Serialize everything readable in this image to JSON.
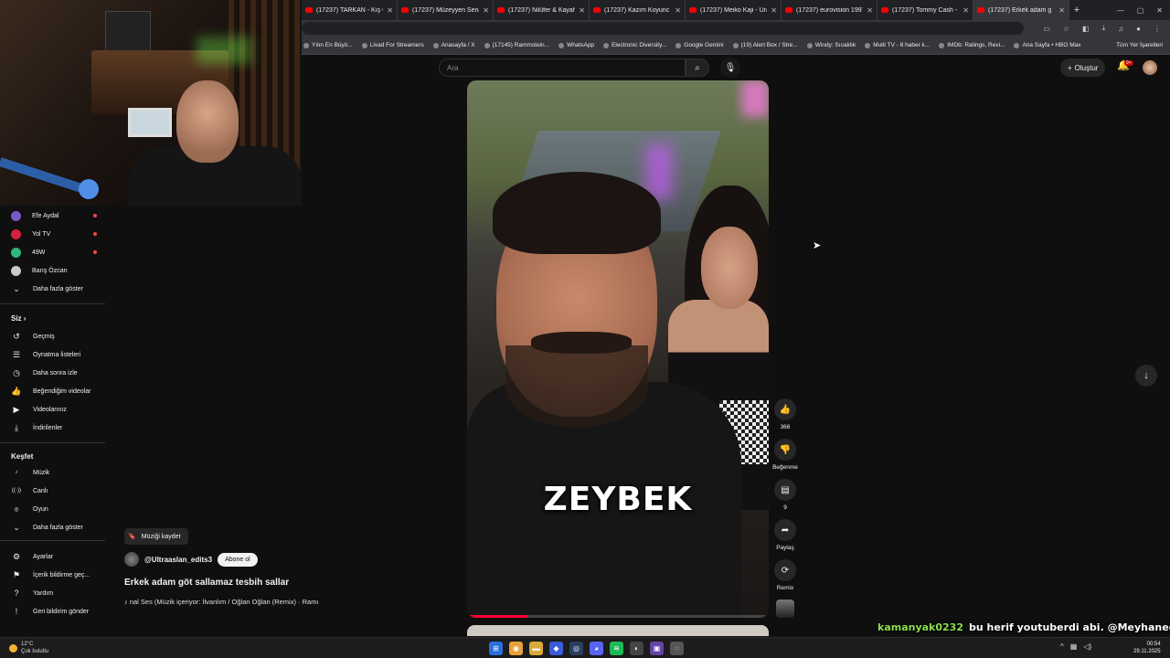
{
  "tabs": [
    {
      "label": "(17237) TARKAN - Kış Gü",
      "active": false
    },
    {
      "label": "(17237) Müzeyyen Senar",
      "active": false
    },
    {
      "label": "(17237) Nilüfer & Kayahan",
      "active": false
    },
    {
      "label": "(17237) Kazım Koyunc",
      "active": false
    },
    {
      "label": "(17237) Meiko Kaji - Ura",
      "active": false
    },
    {
      "label": "(17237) eurovision 1997",
      "active": false
    },
    {
      "label": "(17237) Tommy Cash - Es",
      "active": false
    },
    {
      "label": "(17237) Erkek adam g",
      "active": true
    }
  ],
  "bookmarks": [
    "Yılın En Büyü...",
    "Livad For Streamers",
    "Anasayfa / X",
    "(17145) Rammstein...",
    "WhatsApp",
    "Electronic Diversity...",
    "Google Gemini",
    "(19) Alert Box / Stre...",
    "Windy: Sıcaklık",
    "Multi TV - 6 haber k...",
    "IMDb: Ratings, Revi...",
    "Ana Sayfa • HBO Max"
  ],
  "bookmarks_all": "Tüm Yer İşaretleri",
  "search": {
    "placeholder": "Ara"
  },
  "header": {
    "create_label": "Oluştur",
    "notification_count": "9+"
  },
  "sidebar": {
    "subscriptions": [
      {
        "label": "Efe Aydal",
        "color": "#7a5ac8",
        "live": true
      },
      {
        "label": "Yol TV",
        "color": "#d4213d",
        "live": true
      },
      {
        "label": "49W",
        "color": "#2fb47e",
        "live": true
      },
      {
        "label": "Barış Özcan",
        "color": "#c9c9c9",
        "live": false
      }
    ],
    "show_more_subs": "Daha fazla göster",
    "you_heading": "Siz",
    "you_items": [
      {
        "label": "Geçmiş",
        "icon": "history-icon"
      },
      {
        "label": "Oynatma listeleri",
        "icon": "playlist-icon"
      },
      {
        "label": "Daha sonra izle",
        "icon": "clock-icon"
      },
      {
        "label": "Beğendiğim videolar",
        "icon": "like-icon"
      },
      {
        "label": "Videolarınız",
        "icon": "video-icon"
      },
      {
        "label": "İndirilenler",
        "icon": "download-icon"
      }
    ],
    "explore_heading": "Keşfet",
    "explore_items": [
      {
        "label": "Müzik",
        "icon": "music-icon"
      },
      {
        "label": "Canlı",
        "icon": "live-icon"
      },
      {
        "label": "Oyun",
        "icon": "gaming-icon"
      }
    ],
    "show_more_explore": "Daha fazla göster",
    "footer_items": [
      {
        "label": "Ayarlar",
        "icon": "gear-icon"
      },
      {
        "label": "İçerik bildirme geç...",
        "icon": "flag-icon"
      },
      {
        "label": "Yardım",
        "icon": "help-icon"
      },
      {
        "label": "Geri bildirim gönder",
        "icon": "feedback-icon"
      }
    ]
  },
  "video": {
    "save_music_label": "Müziği kaydet",
    "channel": "@Ultraaslan_edits3",
    "subscribe_label": "Abone ol",
    "title": "Erkek adam göt sallamaz tesbih sallar",
    "music": "♪ nal Ses (Müzik içeriyor: İlvanlım / Oğlan Oğlan (Remix) · Ramı",
    "caption": "ZEYBEK",
    "progress": 0.2
  },
  "actions": {
    "like_count": "368",
    "dislike_label": "Beğenme",
    "comment_count": "9",
    "share_label": "Paylaş",
    "remix_label": "Remix"
  },
  "chat": [
    {
      "user": "kamanyak0232",
      "message": "bu herif youtuberdi abi. @MeyhaneciDimitri"
    },
    {
      "user": "kamanyak0232",
      "message": ""
    }
  ],
  "taskbar": {
    "temperature": "12°C",
    "weather": "Çok bulutlu",
    "time": "00:54",
    "date": "29.11.2025"
  }
}
